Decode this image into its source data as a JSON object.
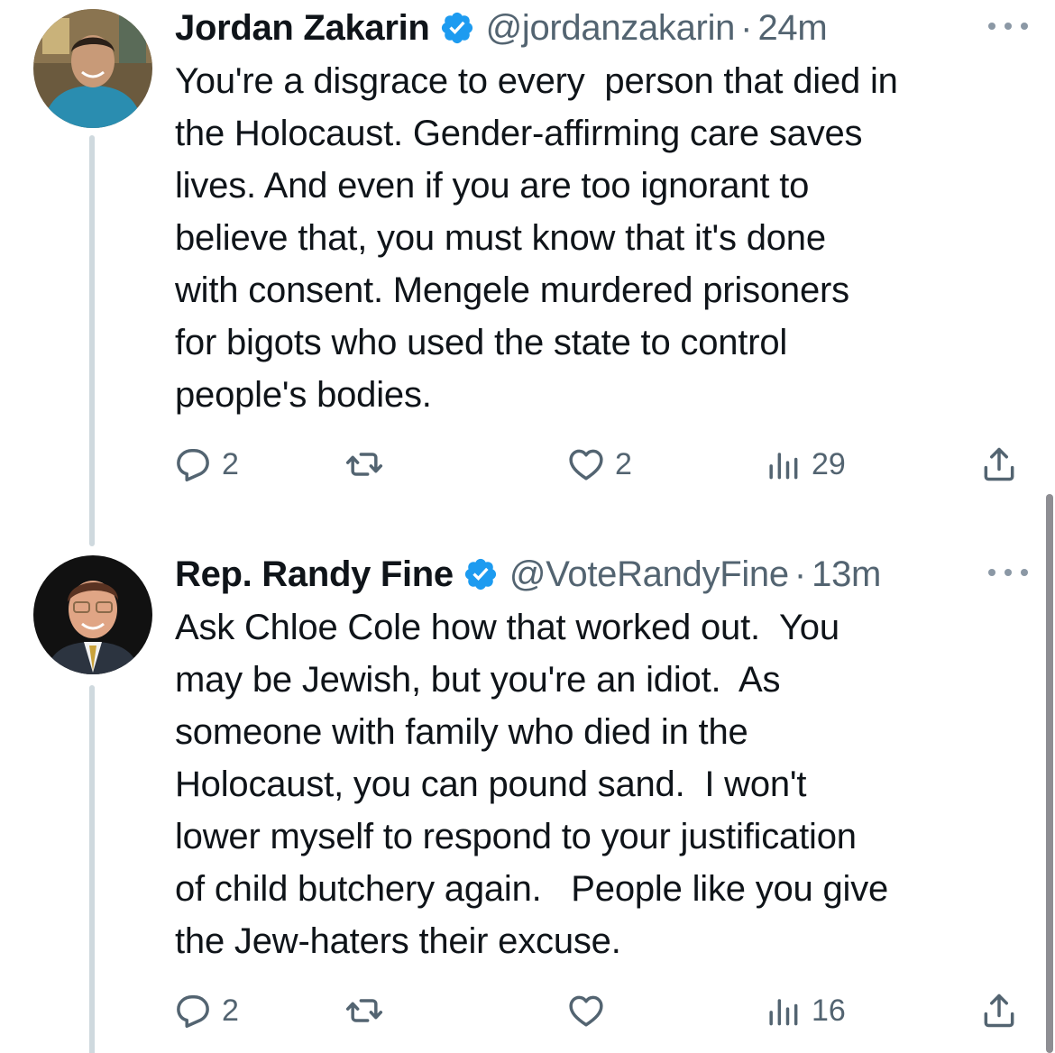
{
  "colors": {
    "text": "#0f1419",
    "secondary": "#536471",
    "verified_badge": "#1d9bf0",
    "thread_line": "#cfd9de"
  },
  "tweets": [
    {
      "name": "Jordan Zakarin",
      "verified": true,
      "verified_icon": "verified-badge-icon",
      "handle": "@jordanzakarin",
      "separator": "·",
      "time": "24m",
      "avatar": "avatar-photo",
      "body": "You're a disgrace to every  person that died in\nthe Holocaust. Gender-affirming care saves\nlives. And even if you are too ignorant to\nbelieve that, you must know that it's done\nwith consent. Mengele murdered prisoners\nfor bigots who used the state to control\npeople's bodies.",
      "actions": {
        "replies": "2",
        "retweets": "",
        "likes": "2",
        "views": "29"
      }
    },
    {
      "name": "Rep. Randy Fine",
      "verified": true,
      "verified_icon": "verified-badge-icon",
      "handle": "@VoteRandyFine",
      "separator": "·",
      "time": "13m",
      "avatar": "avatar-photo",
      "body": "Ask Chloe Cole how that worked out.  You\nmay be Jewish, but you're an idiot.  As\nsomeone with family who died in the\nHolocaust, you can pound sand.  I won't\nlower myself to respond to your justification\nof child butchery again.   People like you give\nthe Jew-haters their excuse.",
      "actions": {
        "replies": "2",
        "retweets": "",
        "likes": "",
        "views": "16"
      }
    }
  ]
}
